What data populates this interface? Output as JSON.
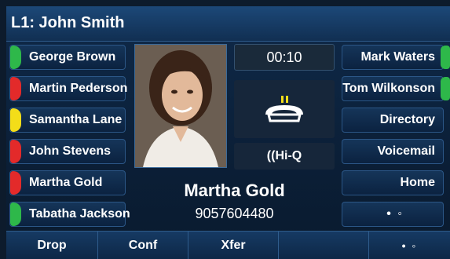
{
  "title": "L1: John Smith",
  "left_keys": [
    {
      "label": "George Brown",
      "status_color": "#2eb84a"
    },
    {
      "label": "Martin Pederson",
      "status_color": "#e32a2a"
    },
    {
      "label": "Samantha Lane",
      "status_color": "#f3dd19"
    },
    {
      "label": "John Stevens",
      "status_color": "#e32a2a"
    },
    {
      "label": "Martha Gold",
      "status_color": "#e32a2a"
    },
    {
      "label": "Tabatha Jackson",
      "status_color": "#2eb84a"
    }
  ],
  "right_keys": [
    {
      "label": "Mark Waters",
      "status_color": "#2eb84a"
    },
    {
      "label": "Tom Wilkonson",
      "status_color": "#2eb84a"
    },
    {
      "label": "Directory"
    },
    {
      "label": "Voicemail"
    },
    {
      "label": "Home"
    },
    {
      "label": "• ◦"
    }
  ],
  "call": {
    "timer": "00:10",
    "hiq_label": "((Hi-Q",
    "caller_name": "Martha Gold",
    "caller_number": "9057604480",
    "icon": "handset-call-icon"
  },
  "softkeys": [
    "Drop",
    "Conf",
    "Xfer",
    "",
    "• ◦"
  ],
  "colors": {
    "accent": "#1c4878",
    "handset": "#f3dd19"
  }
}
